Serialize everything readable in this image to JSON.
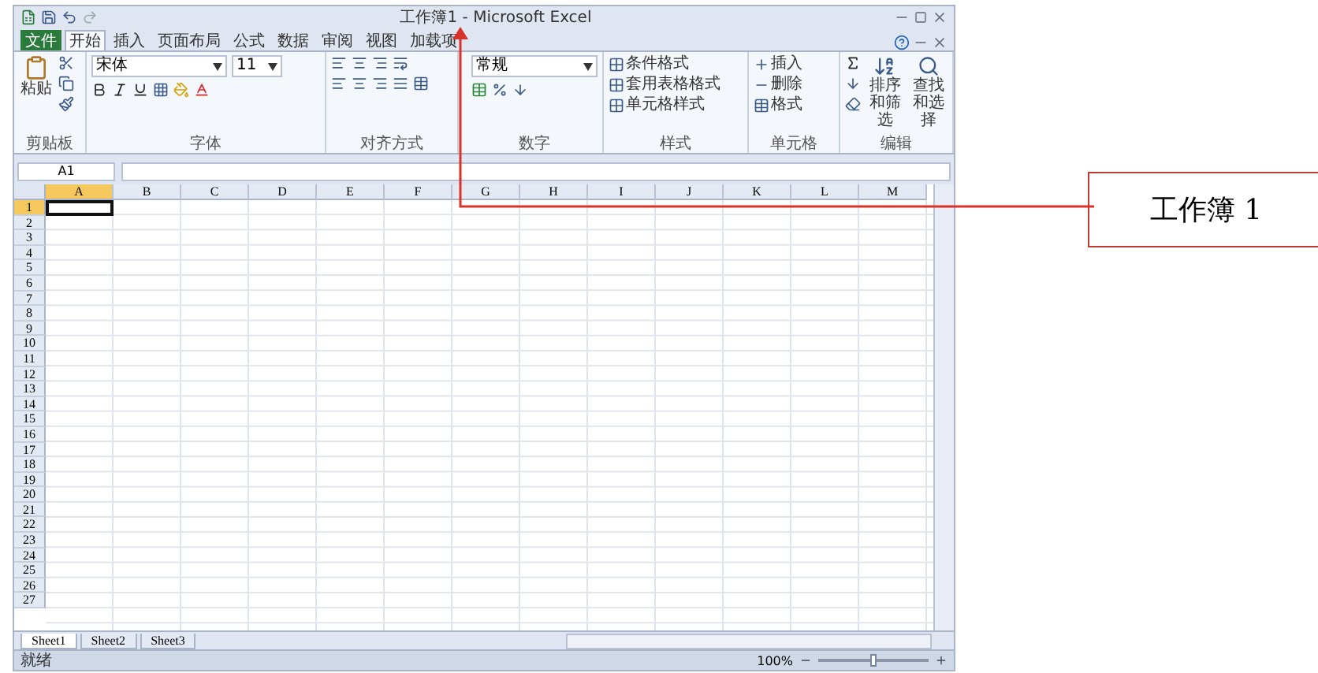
{
  "window": {
    "title": "工作簿1 - Microsoft Excel"
  },
  "ribbon_tabs": [
    {
      "label": "文件",
      "kind": "file",
      "selected": false
    },
    {
      "label": "开始",
      "kind": "tab",
      "selected": true
    },
    {
      "label": "插入",
      "kind": "tab",
      "selected": false
    },
    {
      "label": "页面布局",
      "kind": "tab",
      "selected": false
    },
    {
      "label": "公式",
      "kind": "tab",
      "selected": false
    },
    {
      "label": "数据",
      "kind": "tab",
      "selected": false
    },
    {
      "label": "审阅",
      "kind": "tab",
      "selected": false
    },
    {
      "label": "视图",
      "kind": "tab",
      "selected": false
    },
    {
      "label": "加载项",
      "kind": "tab",
      "selected": false
    }
  ],
  "clipboard": {
    "paste": "粘贴",
    "label": "剪贴板"
  },
  "font": {
    "name": "宋体",
    "size": "11",
    "label": "字体"
  },
  "alignment": {
    "label": "对齐方式"
  },
  "number": {
    "format": "常规",
    "label": "数字"
  },
  "styles": {
    "items": [
      "条件格式",
      "套用表格格式",
      "单元格样式"
    ],
    "label": "样式"
  },
  "cells": {
    "items": [
      "插入",
      "删除",
      "格式"
    ],
    "label": "单元格"
  },
  "editing": {
    "items": [
      "排序和筛选",
      "查找和选择"
    ],
    "label": "编辑"
  },
  "name_box": "A1",
  "columns": [
    {
      "label": "A",
      "selected": true
    },
    {
      "label": "B",
      "selected": false
    },
    {
      "label": "C",
      "selected": false
    },
    {
      "label": "D",
      "selected": false
    },
    {
      "label": "E",
      "selected": false
    },
    {
      "label": "F",
      "selected": false
    },
    {
      "label": "G",
      "selected": false
    },
    {
      "label": "H",
      "selected": false
    },
    {
      "label": "I",
      "selected": false
    },
    {
      "label": "J",
      "selected": false
    },
    {
      "label": "K",
      "selected": false
    },
    {
      "label": "L",
      "selected": false
    },
    {
      "label": "M",
      "selected": false
    }
  ],
  "rows": [
    {
      "label": "1",
      "selected": true
    },
    {
      "label": "2",
      "selected": false
    },
    {
      "label": "3",
      "selected": false
    },
    {
      "label": "4",
      "selected": false
    },
    {
      "label": "5",
      "selected": false
    },
    {
      "label": "6",
      "selected": false
    },
    {
      "label": "7",
      "selected": false
    },
    {
      "label": "8",
      "selected": false
    },
    {
      "label": "9",
      "selected": false
    },
    {
      "label": "10",
      "selected": false
    },
    {
      "label": "11",
      "selected": false
    },
    {
      "label": "12",
      "selected": false
    },
    {
      "label": "13",
      "selected": false
    },
    {
      "label": "14",
      "selected": false
    },
    {
      "label": "15",
      "selected": false
    },
    {
      "label": "16",
      "selected": false
    },
    {
      "label": "17",
      "selected": false
    },
    {
      "label": "18",
      "selected": false
    },
    {
      "label": "19",
      "selected": false
    },
    {
      "label": "20",
      "selected": false
    },
    {
      "label": "21",
      "selected": false
    },
    {
      "label": "22",
      "selected": false
    },
    {
      "label": "23",
      "selected": false
    },
    {
      "label": "24",
      "selected": false
    },
    {
      "label": "25",
      "selected": false
    },
    {
      "label": "26",
      "selected": false
    },
    {
      "label": "27",
      "selected": false
    }
  ],
  "sheets": [
    {
      "label": "Sheet1",
      "selected": true
    },
    {
      "label": "Sheet2",
      "selected": false
    },
    {
      "label": "Sheet3",
      "selected": false
    }
  ],
  "status_bar": {
    "text": "就绪",
    "zoom": "100%",
    "zoom_level": {
      "level": 0.5
    }
  },
  "callout": {
    "label": "工作簿 1"
  }
}
